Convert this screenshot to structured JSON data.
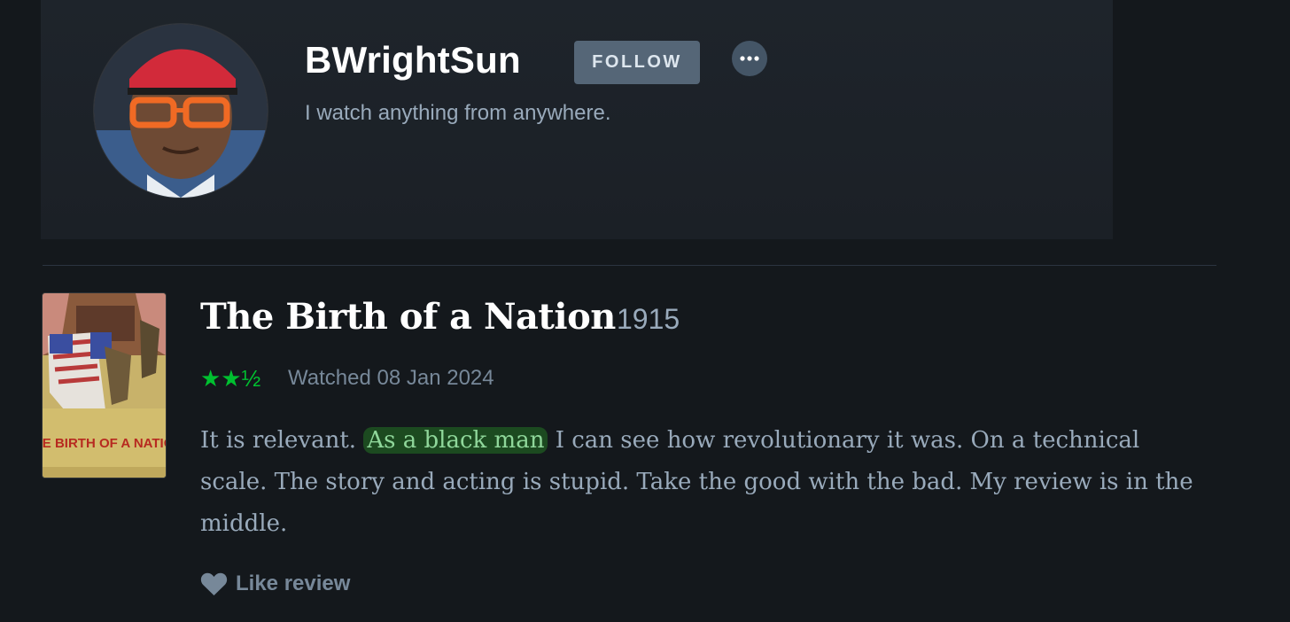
{
  "profile": {
    "username": "BWrightSun",
    "follow_label": "FOLLOW",
    "more_label": "•••",
    "bio": "I watch anything from anywhere."
  },
  "review": {
    "film_title": "The Birth of a Nation",
    "film_year": "1915",
    "rating_stars": "★★½",
    "rating_value": 2.5,
    "watched_label": "Watched 08 Jan 2024",
    "text_before": "It is relevant. ",
    "text_highlight": "As a black man",
    "text_after": " I can see how revolutionary it was. On a technical scale. The story and acting is stupid. Take the good with the bad. My review is in the middle.",
    "like_label": "Like review",
    "poster_title": "THE BIRTH OF A NATION"
  },
  "colors": {
    "background": "#14181c",
    "header_panel": "#1c2228",
    "accent_green": "#00c030",
    "muted_text": "#99aabb",
    "follow_button": "#556677"
  },
  "icons": {
    "more": "more-options-icon",
    "like": "heart-icon"
  }
}
